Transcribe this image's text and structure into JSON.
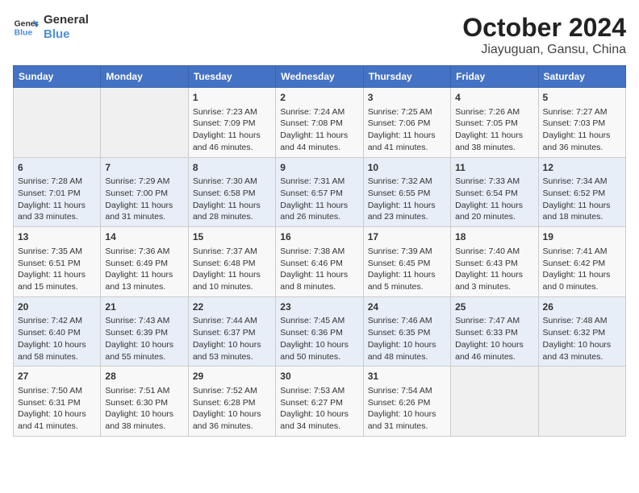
{
  "logo": {
    "line1": "General",
    "line2": "Blue"
  },
  "title": "October 2024",
  "subtitle": "Jiayuguan, Gansu, China",
  "days_of_week": [
    "Sunday",
    "Monday",
    "Tuesday",
    "Wednesday",
    "Thursday",
    "Friday",
    "Saturday"
  ],
  "weeks": [
    [
      {
        "day": "",
        "info": ""
      },
      {
        "day": "",
        "info": ""
      },
      {
        "day": "1",
        "info": "Sunrise: 7:23 AM\nSunset: 7:09 PM\nDaylight: 11 hours and 46 minutes."
      },
      {
        "day": "2",
        "info": "Sunrise: 7:24 AM\nSunset: 7:08 PM\nDaylight: 11 hours and 44 minutes."
      },
      {
        "day": "3",
        "info": "Sunrise: 7:25 AM\nSunset: 7:06 PM\nDaylight: 11 hours and 41 minutes."
      },
      {
        "day": "4",
        "info": "Sunrise: 7:26 AM\nSunset: 7:05 PM\nDaylight: 11 hours and 38 minutes."
      },
      {
        "day": "5",
        "info": "Sunrise: 7:27 AM\nSunset: 7:03 PM\nDaylight: 11 hours and 36 minutes."
      }
    ],
    [
      {
        "day": "6",
        "info": "Sunrise: 7:28 AM\nSunset: 7:01 PM\nDaylight: 11 hours and 33 minutes."
      },
      {
        "day": "7",
        "info": "Sunrise: 7:29 AM\nSunset: 7:00 PM\nDaylight: 11 hours and 31 minutes."
      },
      {
        "day": "8",
        "info": "Sunrise: 7:30 AM\nSunset: 6:58 PM\nDaylight: 11 hours and 28 minutes."
      },
      {
        "day": "9",
        "info": "Sunrise: 7:31 AM\nSunset: 6:57 PM\nDaylight: 11 hours and 26 minutes."
      },
      {
        "day": "10",
        "info": "Sunrise: 7:32 AM\nSunset: 6:55 PM\nDaylight: 11 hours and 23 minutes."
      },
      {
        "day": "11",
        "info": "Sunrise: 7:33 AM\nSunset: 6:54 PM\nDaylight: 11 hours and 20 minutes."
      },
      {
        "day": "12",
        "info": "Sunrise: 7:34 AM\nSunset: 6:52 PM\nDaylight: 11 hours and 18 minutes."
      }
    ],
    [
      {
        "day": "13",
        "info": "Sunrise: 7:35 AM\nSunset: 6:51 PM\nDaylight: 11 hours and 15 minutes."
      },
      {
        "day": "14",
        "info": "Sunrise: 7:36 AM\nSunset: 6:49 PM\nDaylight: 11 hours and 13 minutes."
      },
      {
        "day": "15",
        "info": "Sunrise: 7:37 AM\nSunset: 6:48 PM\nDaylight: 11 hours and 10 minutes."
      },
      {
        "day": "16",
        "info": "Sunrise: 7:38 AM\nSunset: 6:46 PM\nDaylight: 11 hours and 8 minutes."
      },
      {
        "day": "17",
        "info": "Sunrise: 7:39 AM\nSunset: 6:45 PM\nDaylight: 11 hours and 5 minutes."
      },
      {
        "day": "18",
        "info": "Sunrise: 7:40 AM\nSunset: 6:43 PM\nDaylight: 11 hours and 3 minutes."
      },
      {
        "day": "19",
        "info": "Sunrise: 7:41 AM\nSunset: 6:42 PM\nDaylight: 11 hours and 0 minutes."
      }
    ],
    [
      {
        "day": "20",
        "info": "Sunrise: 7:42 AM\nSunset: 6:40 PM\nDaylight: 10 hours and 58 minutes."
      },
      {
        "day": "21",
        "info": "Sunrise: 7:43 AM\nSunset: 6:39 PM\nDaylight: 10 hours and 55 minutes."
      },
      {
        "day": "22",
        "info": "Sunrise: 7:44 AM\nSunset: 6:37 PM\nDaylight: 10 hours and 53 minutes."
      },
      {
        "day": "23",
        "info": "Sunrise: 7:45 AM\nSunset: 6:36 PM\nDaylight: 10 hours and 50 minutes."
      },
      {
        "day": "24",
        "info": "Sunrise: 7:46 AM\nSunset: 6:35 PM\nDaylight: 10 hours and 48 minutes."
      },
      {
        "day": "25",
        "info": "Sunrise: 7:47 AM\nSunset: 6:33 PM\nDaylight: 10 hours and 46 minutes."
      },
      {
        "day": "26",
        "info": "Sunrise: 7:48 AM\nSunset: 6:32 PM\nDaylight: 10 hours and 43 minutes."
      }
    ],
    [
      {
        "day": "27",
        "info": "Sunrise: 7:50 AM\nSunset: 6:31 PM\nDaylight: 10 hours and 41 minutes."
      },
      {
        "day": "28",
        "info": "Sunrise: 7:51 AM\nSunset: 6:30 PM\nDaylight: 10 hours and 38 minutes."
      },
      {
        "day": "29",
        "info": "Sunrise: 7:52 AM\nSunset: 6:28 PM\nDaylight: 10 hours and 36 minutes."
      },
      {
        "day": "30",
        "info": "Sunrise: 7:53 AM\nSunset: 6:27 PM\nDaylight: 10 hours and 34 minutes."
      },
      {
        "day": "31",
        "info": "Sunrise: 7:54 AM\nSunset: 6:26 PM\nDaylight: 10 hours and 31 minutes."
      },
      {
        "day": "",
        "info": ""
      },
      {
        "day": "",
        "info": ""
      }
    ]
  ]
}
